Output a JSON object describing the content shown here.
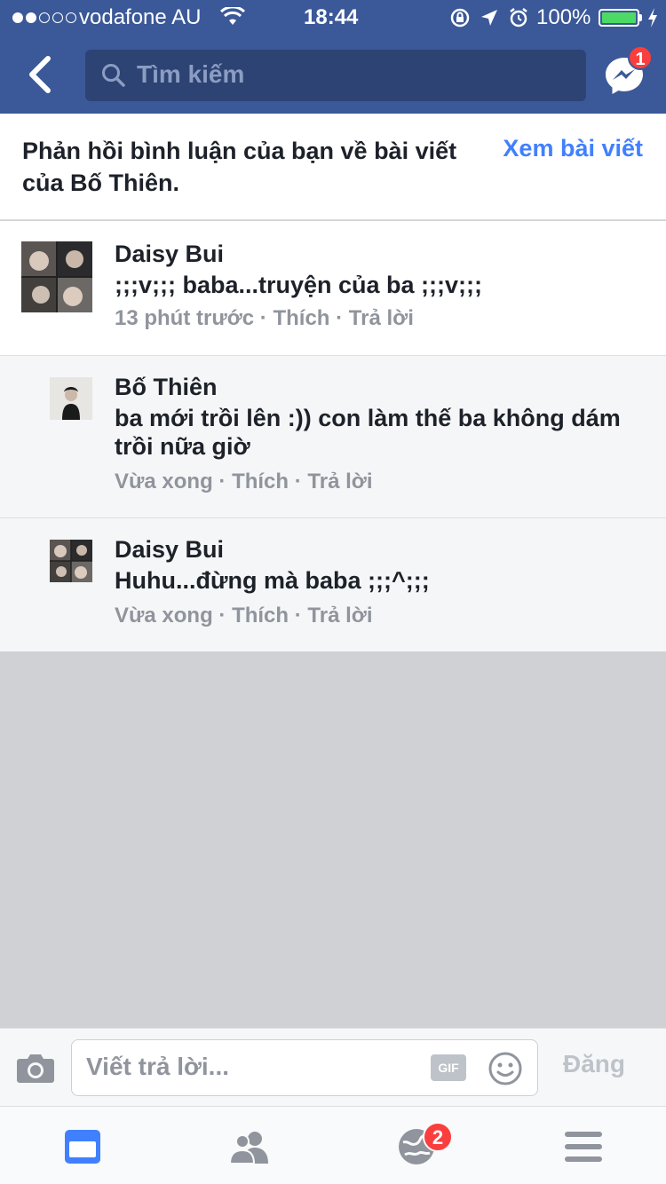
{
  "status_bar": {
    "carrier": "vodafone AU",
    "time": "18:44",
    "battery": "100%"
  },
  "nav": {
    "search_placeholder": "Tìm kiếm",
    "messenger_badge": "1"
  },
  "header": {
    "title_part1": "Phản hồi bình luận của bạn về ",
    "title_part2": "bài viết của Bố Thiên.",
    "view_post": "Xem bài viết"
  },
  "comments": [
    {
      "name": "Daisy Bui",
      "text": ";;;v;;; baba...truyện của ba ;;;v;;;",
      "time": "13 phút trước",
      "like": "Thích",
      "reply": "Trả lời"
    },
    {
      "name": "Bố Thiên",
      "text": "ba mới trồi lên :)) con làm thế ba không dám trồi nữa giờ",
      "time": "Vừa xong",
      "like": "Thích",
      "reply": "Trả lời"
    },
    {
      "name": "Daisy Bui",
      "text": "Huhu...đừng mà baba ;;;^;;;",
      "time": "Vừa xong",
      "like": "Thích",
      "reply": "Trả lời"
    }
  ],
  "composer": {
    "placeholder": "Viết trả lời...",
    "gif": "GIF",
    "post": "Đăng"
  },
  "tabbar": {
    "notifications_badge": "2"
  },
  "colors": {
    "brand": "#3b5998",
    "link": "#4080ff",
    "badge": "#fa3e3e"
  }
}
